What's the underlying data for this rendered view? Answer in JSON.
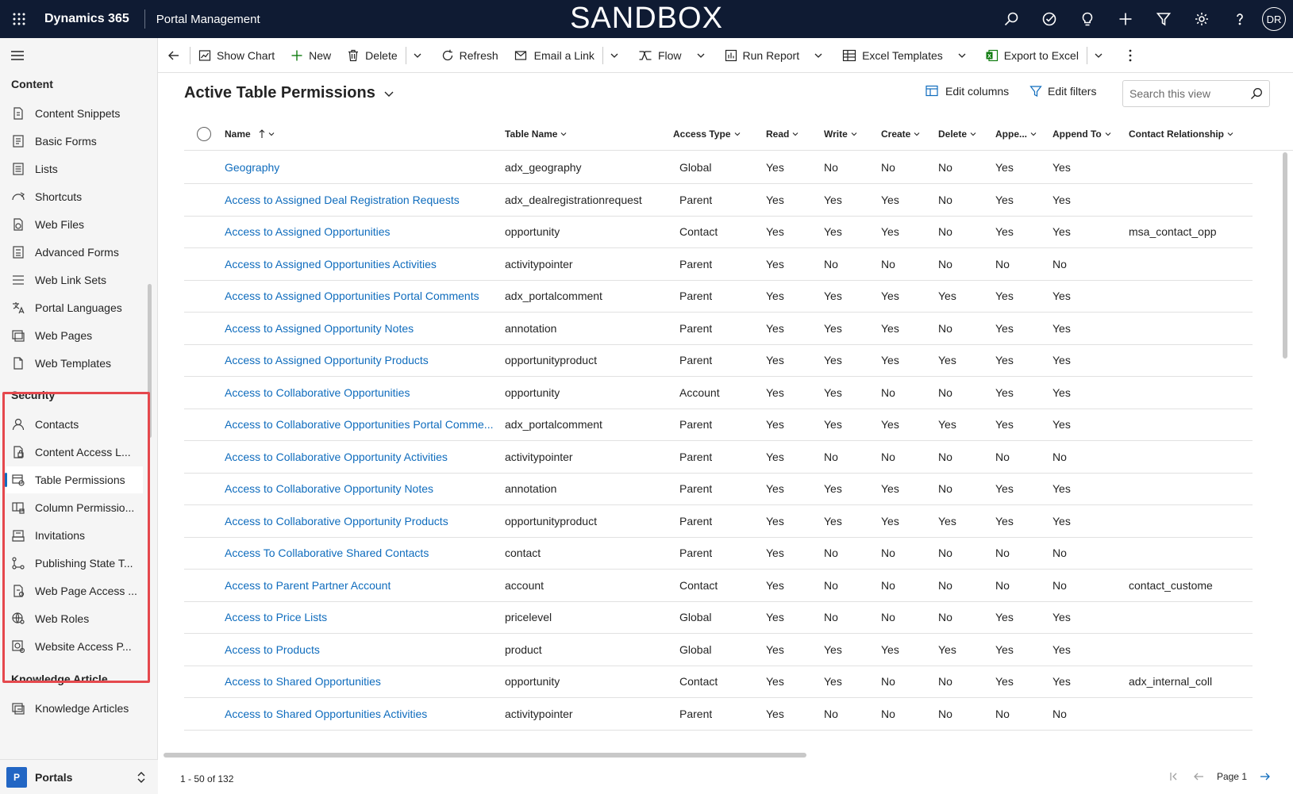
{
  "topbar": {
    "app_name": "Dynamics 365",
    "area_name": "Portal Management",
    "environment_banner": "SANDBOX",
    "avatar_initials": "DR",
    "icons": [
      "search-icon",
      "task-check-icon",
      "lightbulb-icon",
      "plus-icon",
      "filter-icon",
      "gear-icon",
      "help-icon"
    ]
  },
  "sidebar": {
    "groups": [
      {
        "title": "Content",
        "items": [
          {
            "label": "Content Snippets",
            "icon": "snippet-icon"
          },
          {
            "label": "Basic Forms",
            "icon": "form-icon"
          },
          {
            "label": "Lists",
            "icon": "list-icon"
          },
          {
            "label": "Shortcuts",
            "icon": "shortcut-icon"
          },
          {
            "label": "Web Files",
            "icon": "web-file-icon"
          },
          {
            "label": "Advanced Forms",
            "icon": "advanced-form-icon"
          },
          {
            "label": "Web Link Sets",
            "icon": "link-set-icon"
          },
          {
            "label": "Portal Languages",
            "icon": "language-icon"
          },
          {
            "label": "Web Pages",
            "icon": "web-page-icon"
          },
          {
            "label": "Web Templates",
            "icon": "template-icon"
          }
        ]
      },
      {
        "title": "Security",
        "items": [
          {
            "label": "Contacts",
            "icon": "person-icon"
          },
          {
            "label": "Content Access L...",
            "icon": "lock-document-icon"
          },
          {
            "label": "Table Permissions",
            "icon": "table-permission-icon",
            "selected": true
          },
          {
            "label": "Column Permissio...",
            "icon": "column-permission-icon"
          },
          {
            "label": "Invitations",
            "icon": "invitation-icon"
          },
          {
            "label": "Publishing State T...",
            "icon": "flow-state-icon"
          },
          {
            "label": "Web Page Access ...",
            "icon": "page-access-icon"
          },
          {
            "label": "Web Roles",
            "icon": "globe-person-icon"
          },
          {
            "label": "Website Access P...",
            "icon": "website-access-icon"
          }
        ]
      },
      {
        "title": "Knowledge Article",
        "items": [
          {
            "label": "Knowledge Articles",
            "icon": "article-icon"
          }
        ]
      }
    ],
    "area_switcher": {
      "badge": "P",
      "label": "Portals"
    }
  },
  "commandbar": {
    "show_chart": "Show Chart",
    "new": "New",
    "delete": "Delete",
    "refresh": "Refresh",
    "email_link": "Email a Link",
    "flow": "Flow",
    "run_report": "Run Report",
    "excel_templates": "Excel Templates",
    "export_excel": "Export to Excel"
  },
  "view": {
    "title": "Active Table Permissions",
    "edit_columns": "Edit columns",
    "edit_filters": "Edit filters",
    "search_placeholder": "Search this view"
  },
  "grid": {
    "columns": [
      "Name",
      "Table Name",
      "Access Type",
      "Read",
      "Write",
      "Create",
      "Delete",
      "Appe...",
      "Append To",
      "Contact Relationship"
    ],
    "sort": {
      "column": "Name",
      "direction": "ascending"
    },
    "rows": [
      [
        "Geography",
        "adx_geography",
        "Global",
        "Yes",
        "No",
        "No",
        "No",
        "Yes",
        "Yes",
        ""
      ],
      [
        "Access to Assigned Deal Registration Requests",
        "adx_dealregistrationrequest",
        "Parent",
        "Yes",
        "Yes",
        "Yes",
        "No",
        "Yes",
        "Yes",
        ""
      ],
      [
        "Access to Assigned Opportunities",
        "opportunity",
        "Contact",
        "Yes",
        "Yes",
        "Yes",
        "No",
        "Yes",
        "Yes",
        "msa_contact_opp"
      ],
      [
        "Access to Assigned Opportunities Activities",
        "activitypointer",
        "Parent",
        "Yes",
        "No",
        "No",
        "No",
        "No",
        "No",
        ""
      ],
      [
        "Access to Assigned Opportunities Portal Comments",
        "adx_portalcomment",
        "Parent",
        "Yes",
        "Yes",
        "Yes",
        "Yes",
        "Yes",
        "Yes",
        ""
      ],
      [
        "Access to Assigned Opportunity Notes",
        "annotation",
        "Parent",
        "Yes",
        "Yes",
        "Yes",
        "No",
        "Yes",
        "Yes",
        ""
      ],
      [
        "Access to Assigned Opportunity Products",
        "opportunityproduct",
        "Parent",
        "Yes",
        "Yes",
        "Yes",
        "Yes",
        "Yes",
        "Yes",
        ""
      ],
      [
        "Access to Collaborative Opportunities",
        "opportunity",
        "Account",
        "Yes",
        "Yes",
        "No",
        "No",
        "Yes",
        "Yes",
        ""
      ],
      [
        "Access to Collaborative Opportunities Portal Comme...",
        "adx_portalcomment",
        "Parent",
        "Yes",
        "Yes",
        "Yes",
        "Yes",
        "Yes",
        "Yes",
        ""
      ],
      [
        "Access to Collaborative Opportunity Activities",
        "activitypointer",
        "Parent",
        "Yes",
        "No",
        "No",
        "No",
        "No",
        "No",
        ""
      ],
      [
        "Access to Collaborative Opportunity Notes",
        "annotation",
        "Parent",
        "Yes",
        "Yes",
        "Yes",
        "No",
        "Yes",
        "Yes",
        ""
      ],
      [
        "Access to Collaborative Opportunity Products",
        "opportunityproduct",
        "Parent",
        "Yes",
        "Yes",
        "Yes",
        "Yes",
        "Yes",
        "Yes",
        ""
      ],
      [
        "Access To Collaborative Shared Contacts",
        "contact",
        "Parent",
        "Yes",
        "No",
        "No",
        "No",
        "No",
        "No",
        ""
      ],
      [
        "Access to Parent Partner Account",
        "account",
        "Contact",
        "Yes",
        "No",
        "No",
        "No",
        "No",
        "No",
        "contact_custome"
      ],
      [
        "Access to Price Lists",
        "pricelevel",
        "Global",
        "Yes",
        "No",
        "No",
        "No",
        "Yes",
        "Yes",
        ""
      ],
      [
        "Access to Products",
        "product",
        "Global",
        "Yes",
        "Yes",
        "Yes",
        "Yes",
        "Yes",
        "Yes",
        ""
      ],
      [
        "Access to Shared Opportunities",
        "opportunity",
        "Contact",
        "Yes",
        "Yes",
        "No",
        "No",
        "Yes",
        "Yes",
        "adx_internal_coll"
      ],
      [
        "Access to Shared Opportunities Activities",
        "activitypointer",
        "Parent",
        "Yes",
        "No",
        "No",
        "No",
        "No",
        "No",
        ""
      ]
    ]
  },
  "footer": {
    "record_count": "1 - 50 of 132",
    "page_label": "Page 1"
  },
  "colors": {
    "topbar_bg": "#0f1b33",
    "link": "#0f6cbd",
    "highlight_border": "#e5484d"
  }
}
